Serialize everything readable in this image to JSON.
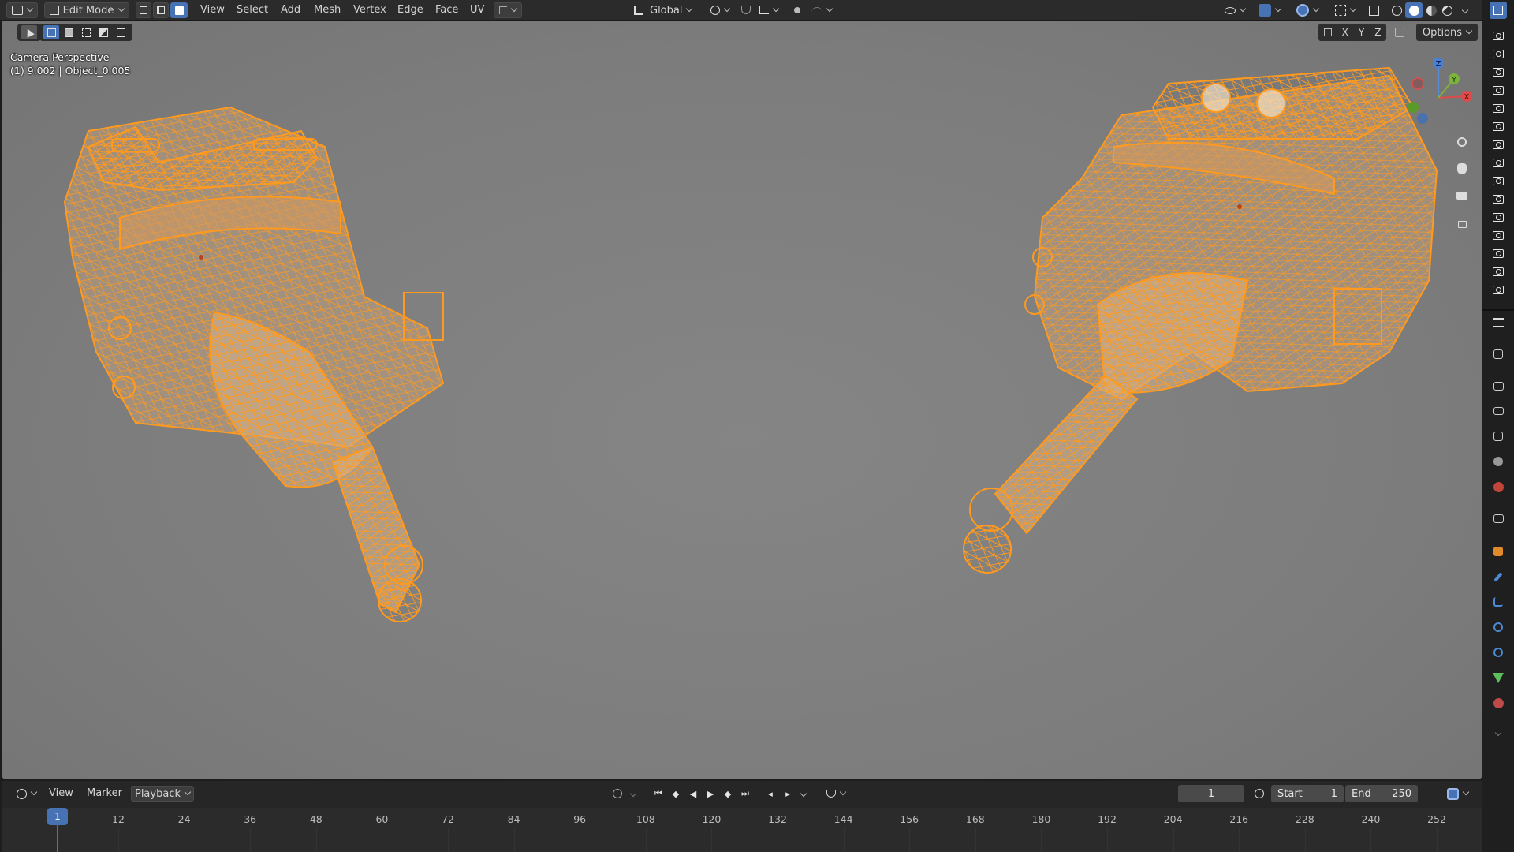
{
  "header": {
    "mode_label": "Edit Mode",
    "menus": [
      "View",
      "Select",
      "Add",
      "Mesh",
      "Vertex",
      "Edge",
      "Face",
      "UV"
    ],
    "transform_orientation": "Global",
    "options_label": "Options",
    "axis_labels": [
      "X",
      "Y",
      "Z"
    ]
  },
  "viewport": {
    "view_name": "Camera Perspective",
    "object_info": "(1) 9.002 | Object_0.005",
    "gizmo": {
      "x": "X",
      "y": "Y",
      "z": "Z"
    },
    "colors": {
      "wire": "#ff9a1f",
      "wire_fill": "#d6a876",
      "background": "#7f7f7f"
    }
  },
  "timeline": {
    "menus": [
      "View",
      "Marker",
      "Playback"
    ],
    "current_frame": "1",
    "start_label": "Start",
    "start_value": "1",
    "end_label": "End",
    "end_value": "250",
    "playhead_label": "1",
    "ticks": [
      "12",
      "24",
      "36",
      "48",
      "60",
      "72",
      "84",
      "96",
      "108",
      "120",
      "132",
      "144",
      "156",
      "168",
      "180",
      "192",
      "204",
      "216",
      "228",
      "240",
      "252"
    ]
  },
  "accent_color": "#4772b3",
  "icons": [
    "editor-type-icon",
    "vertex-select-icon",
    "edge-select-icon",
    "face-select-icon",
    "pivot-icon",
    "snap-icon",
    "proportional-icon",
    "overlay-icon",
    "shading-wireframe-icon",
    "shading-solid-icon",
    "shading-material-icon",
    "shading-rendered-icon",
    "zoom-icon",
    "hand-icon",
    "camera-view-icon",
    "lock-icon",
    "camera-icon"
  ]
}
